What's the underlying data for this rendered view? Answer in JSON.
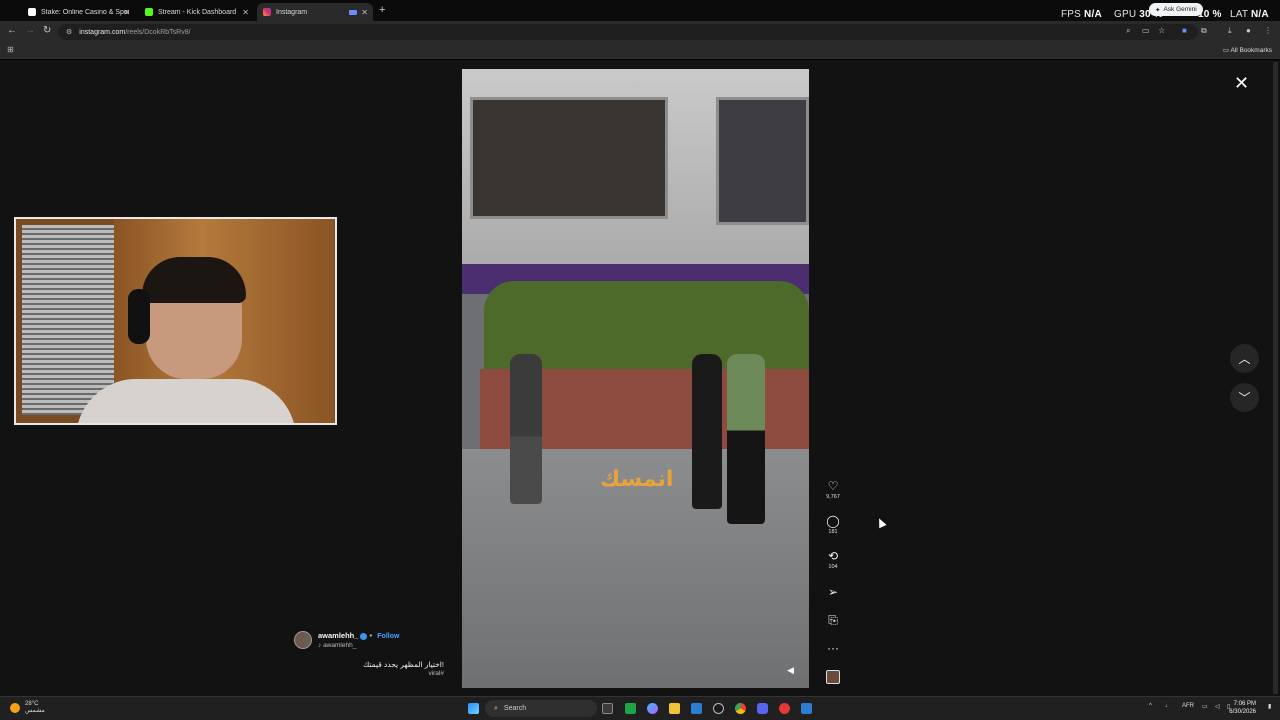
{
  "browser": {
    "tabs": [
      {
        "title": "Stake: Online Casino & Sports B",
        "favicon_color": "#ffffff"
      },
      {
        "title": "Stream - Kick Dashboard",
        "favicon_color": "#53fc18"
      },
      {
        "title": "Instagram",
        "favicon_color": "#e1306c"
      }
    ],
    "new_tab": "+",
    "url_domain": "instagram.com",
    "url_path": "/reels/DcokRbTsRv8/",
    "ask_gemini": "Ask Gemini",
    "all_bookmarks": "All Bookmarks"
  },
  "hud": {
    "fps_label": "FPS",
    "fps_value": "N/A",
    "gpu_label": "GPU",
    "gpu_value": "30 %",
    "cpu_value": "10 %",
    "lat_label": "LAT",
    "lat_value": "N/A"
  },
  "reel": {
    "overlay_text": "انمسك",
    "likes": "9,767",
    "comments": "181",
    "reposts": "104",
    "username": "awamlehh_",
    "follow": "Follow",
    "audio": "awamlehh_",
    "caption": "اختيار المظهر يحدد قيمتك!",
    "hashtag": "viral#"
  },
  "taskbar": {
    "weather_temp": "28°C",
    "weather_desc": "مشمس",
    "search_placeholder": "Search",
    "lang": "AFR",
    "time": "7:06 PM",
    "date": "6/30/2026"
  },
  "colors": {
    "instagram_follow": "#4aa3ff",
    "overlay_text": "#e7a43a",
    "verified": "#3897f0"
  }
}
